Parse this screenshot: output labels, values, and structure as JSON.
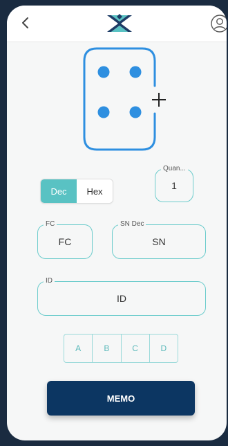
{
  "colors": {
    "accent": "#59c2c3",
    "outline": "#6ccccc",
    "dot": "#2e8fe0",
    "card_outline": "#2e8fe0",
    "primary_button": "#0c3662",
    "frame": "#1a2b40"
  },
  "header": {
    "back_icon": "chevron-left-icon",
    "logo_icon": "brand-logo-icon",
    "profile_icon": "user-profile-icon"
  },
  "card": {
    "plus_symbol": "+",
    "dot_count": 4
  },
  "mode_toggle": {
    "options": [
      "Dec",
      "Hex"
    ],
    "selected": "Dec"
  },
  "quantity": {
    "label": "Quan...",
    "value": "1"
  },
  "fc_field": {
    "label": "FC",
    "value": "FC"
  },
  "sn_field": {
    "label": "SN Dec",
    "value": "SN"
  },
  "id_field": {
    "label": "ID",
    "value": "ID"
  },
  "channels": [
    "A",
    "B",
    "C",
    "D"
  ],
  "memo_button": {
    "label": "MEMO"
  }
}
